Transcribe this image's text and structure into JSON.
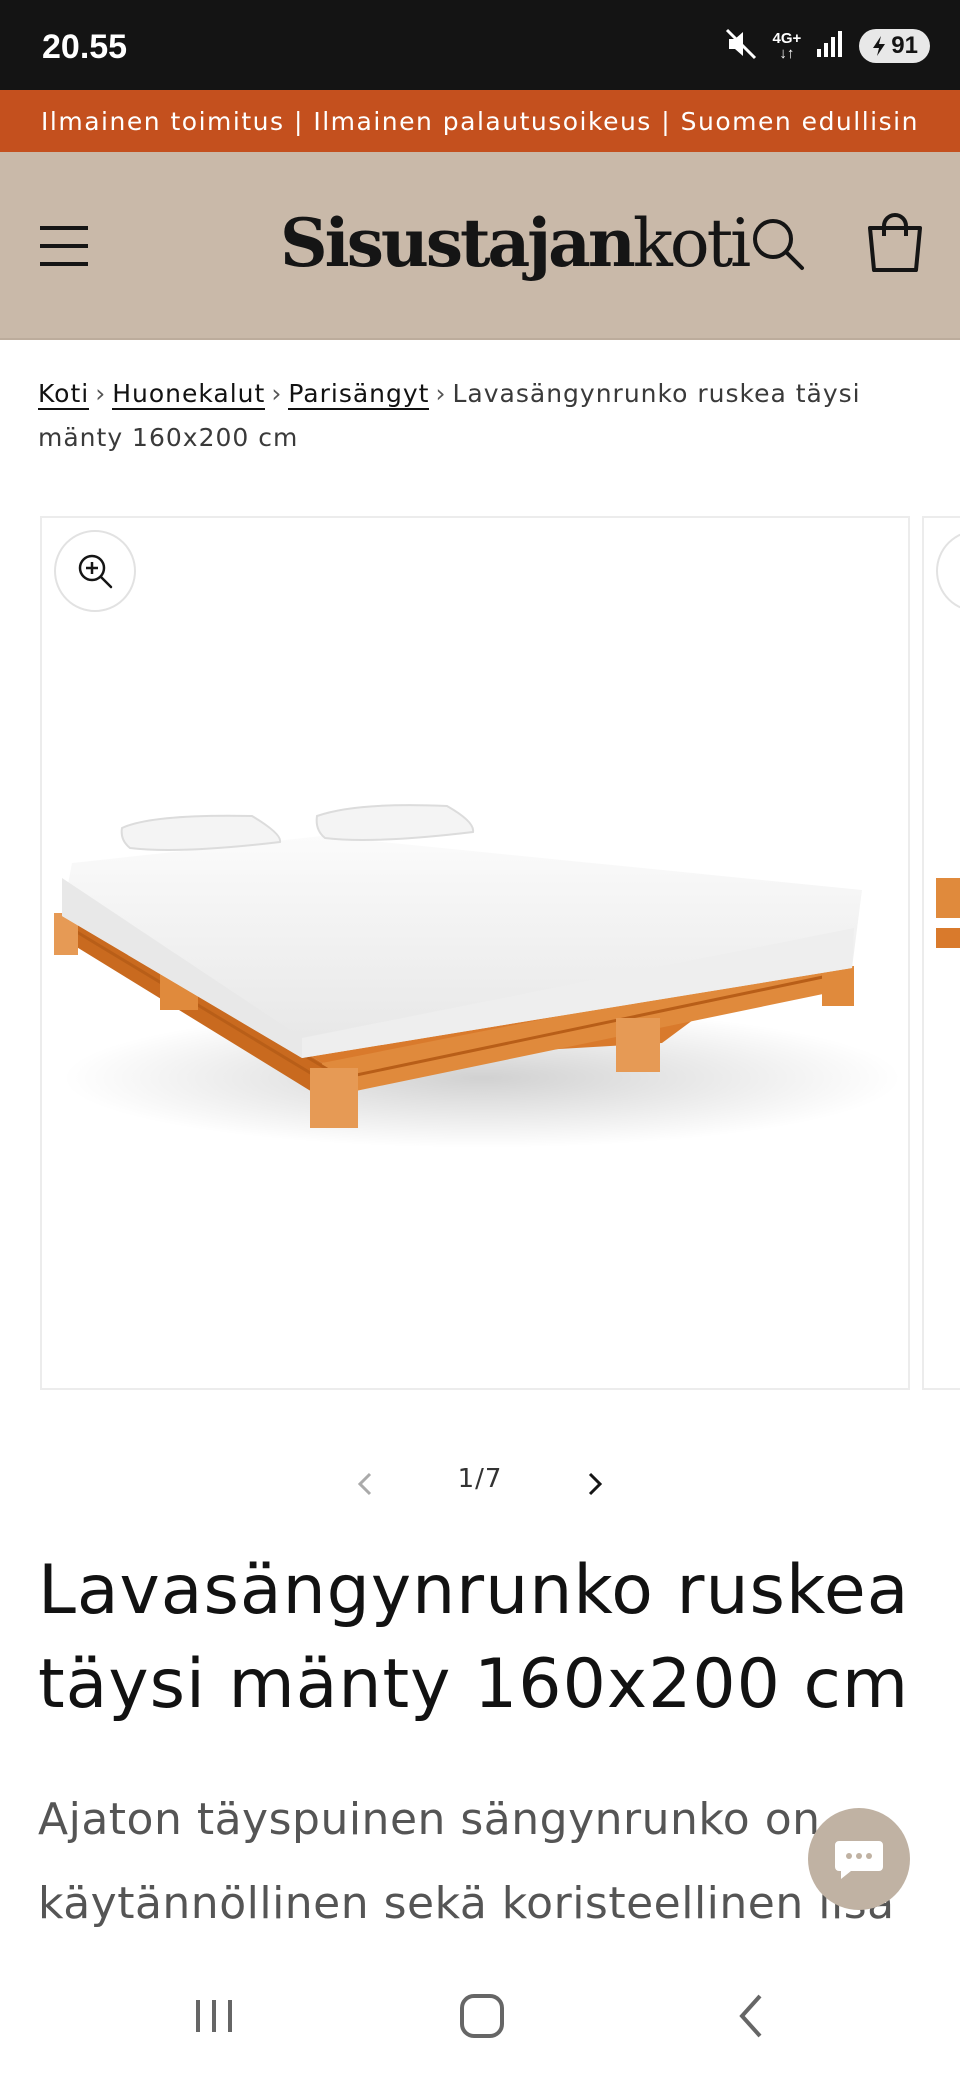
{
  "status_bar": {
    "time": "20.55",
    "network": "4G+",
    "battery": "91",
    "icons": [
      "mute-icon",
      "network-icon",
      "signal-icon",
      "battery-icon"
    ]
  },
  "announcement": {
    "text": "Ilmainen toimitus | Ilmainen palautusoikeus | Suomen edullisin"
  },
  "header": {
    "logo_bold": "Sisustajan",
    "logo_light": "koti",
    "icons": [
      "menu-icon",
      "search-icon",
      "cart-icon"
    ]
  },
  "breadcrumb": {
    "items": [
      "Koti",
      "Huonekalut",
      "Parisängyt"
    ],
    "separator": "›",
    "current": "Lavasängynrunko ruskea täysi mänty 160x200 cm"
  },
  "gallery": {
    "current": 1,
    "total": 7,
    "counter": "1/7",
    "icons": [
      "zoom-in-icon",
      "chevron-left-icon",
      "chevron-right-icon"
    ]
  },
  "product": {
    "title": "Lavasängynrunko ruskea täysi mänty 160x200 cm",
    "description": "Ajaton täyspuinen sängynrunko on käytännöllinen sekä koristeellinen lisä"
  },
  "chat": {
    "icon": "chat-bubble-icon"
  },
  "nav_bar": {
    "icons": [
      "recents-icon",
      "home-icon",
      "back-icon"
    ]
  },
  "colors": {
    "announcement_bg": "#c4501e",
    "header_bg": "#c9b9a9",
    "status_bar_bg": "#141414",
    "chat_bg": "#c0b2a3",
    "wood": "#e08a3c"
  }
}
